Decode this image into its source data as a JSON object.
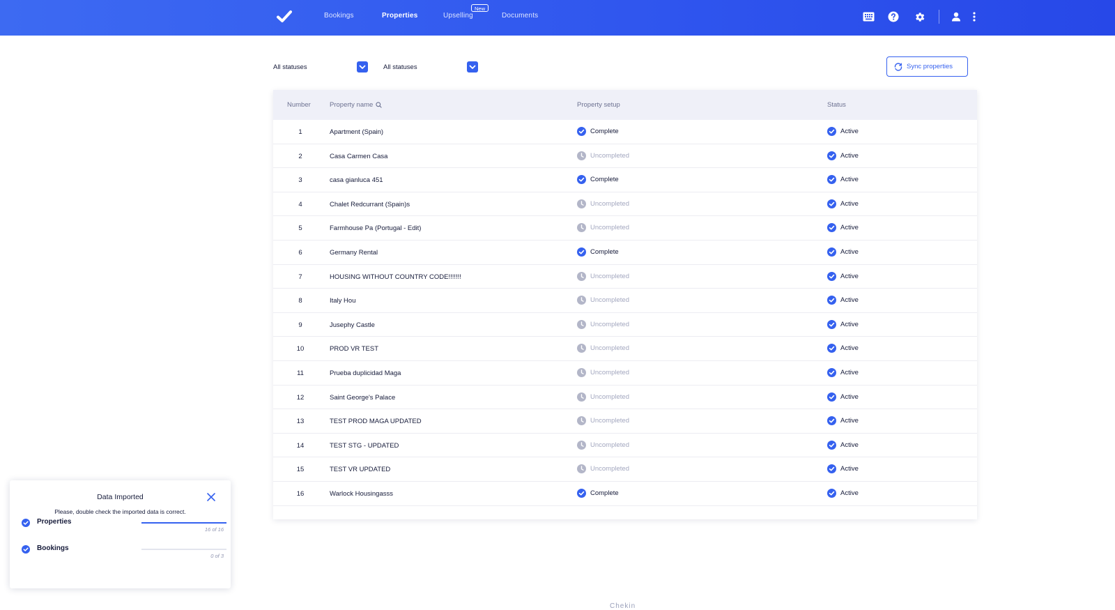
{
  "nav": {
    "items": [
      {
        "label": "Bookings",
        "active": false
      },
      {
        "label": "Properties",
        "active": true
      },
      {
        "label": "Upselling",
        "active": false
      },
      {
        "label": "Documents",
        "active": false
      }
    ],
    "new_badge": "New",
    "icons": [
      "keyboard-icon",
      "help-icon",
      "gear-icon",
      "user-icon",
      "more-vertical-icon"
    ]
  },
  "filters": [
    {
      "label": "All statuses"
    },
    {
      "label": "All statuses"
    }
  ],
  "sync_button": {
    "label": "Sync properties"
  },
  "table": {
    "headers": {
      "number": "Number",
      "name": "Property name",
      "setup": "Property setup",
      "status": "Status"
    },
    "rows": [
      {
        "number": "1",
        "name": "Apartment (Spain)",
        "setup": "Complete",
        "status": "Active"
      },
      {
        "number": "2",
        "name": "Casa Carmen Casa",
        "setup": "Uncompleted",
        "status": "Active"
      },
      {
        "number": "3",
        "name": "casa gianluca 451",
        "setup": "Complete",
        "status": "Active"
      },
      {
        "number": "4",
        "name": "Chalet Redcurrant (Spain)s",
        "setup": "Uncompleted",
        "status": "Active"
      },
      {
        "number": "5",
        "name": "Farmhouse Pa (Portugal - Edit)",
        "setup": "Uncompleted",
        "status": "Active"
      },
      {
        "number": "6",
        "name": "Germany Rental",
        "setup": "Complete",
        "status": "Active"
      },
      {
        "number": "7",
        "name": "HOUSING WITHOUT COUNTRY CODE!!!!!!!",
        "setup": "Uncompleted",
        "status": "Active"
      },
      {
        "number": "8",
        "name": "Italy Hou",
        "setup": "Uncompleted",
        "status": "Active"
      },
      {
        "number": "9",
        "name": "Jusephy Castle",
        "setup": "Uncompleted",
        "status": "Active"
      },
      {
        "number": "10",
        "name": "PROD VR TEST",
        "setup": "Uncompleted",
        "status": "Active"
      },
      {
        "number": "11",
        "name": "Prueba duplicidad Maga",
        "setup": "Uncompleted",
        "status": "Active"
      },
      {
        "number": "12",
        "name": "Saint George's Palace",
        "setup": "Uncompleted",
        "status": "Active"
      },
      {
        "number": "13",
        "name": "TEST PROD MAGA UPDATED",
        "setup": "Uncompleted",
        "status": "Active"
      },
      {
        "number": "14",
        "name": "TEST STG - UPDATED",
        "setup": "Uncompleted",
        "status": "Active"
      },
      {
        "number": "15",
        "name": "TEST VR UPDATED",
        "setup": "Uncompleted",
        "status": "Active"
      },
      {
        "number": "16",
        "name": "Warlock Housingasss",
        "setup": "Complete",
        "status": "Active"
      }
    ]
  },
  "toast": {
    "title": "Data Imported",
    "subtitle": "Please, double check the imported data is correct.",
    "items": [
      {
        "label": "Properties",
        "count": "16 of 16",
        "progress": 1.0
      },
      {
        "label": "Bookings",
        "count": "0 of 3",
        "progress": 0.0
      }
    ]
  },
  "footer": {
    "brand": "Chekin"
  },
  "colors": {
    "primary": "#3561ef",
    "muted": "#a3a7bf",
    "header_bg": "#eff0f8"
  }
}
